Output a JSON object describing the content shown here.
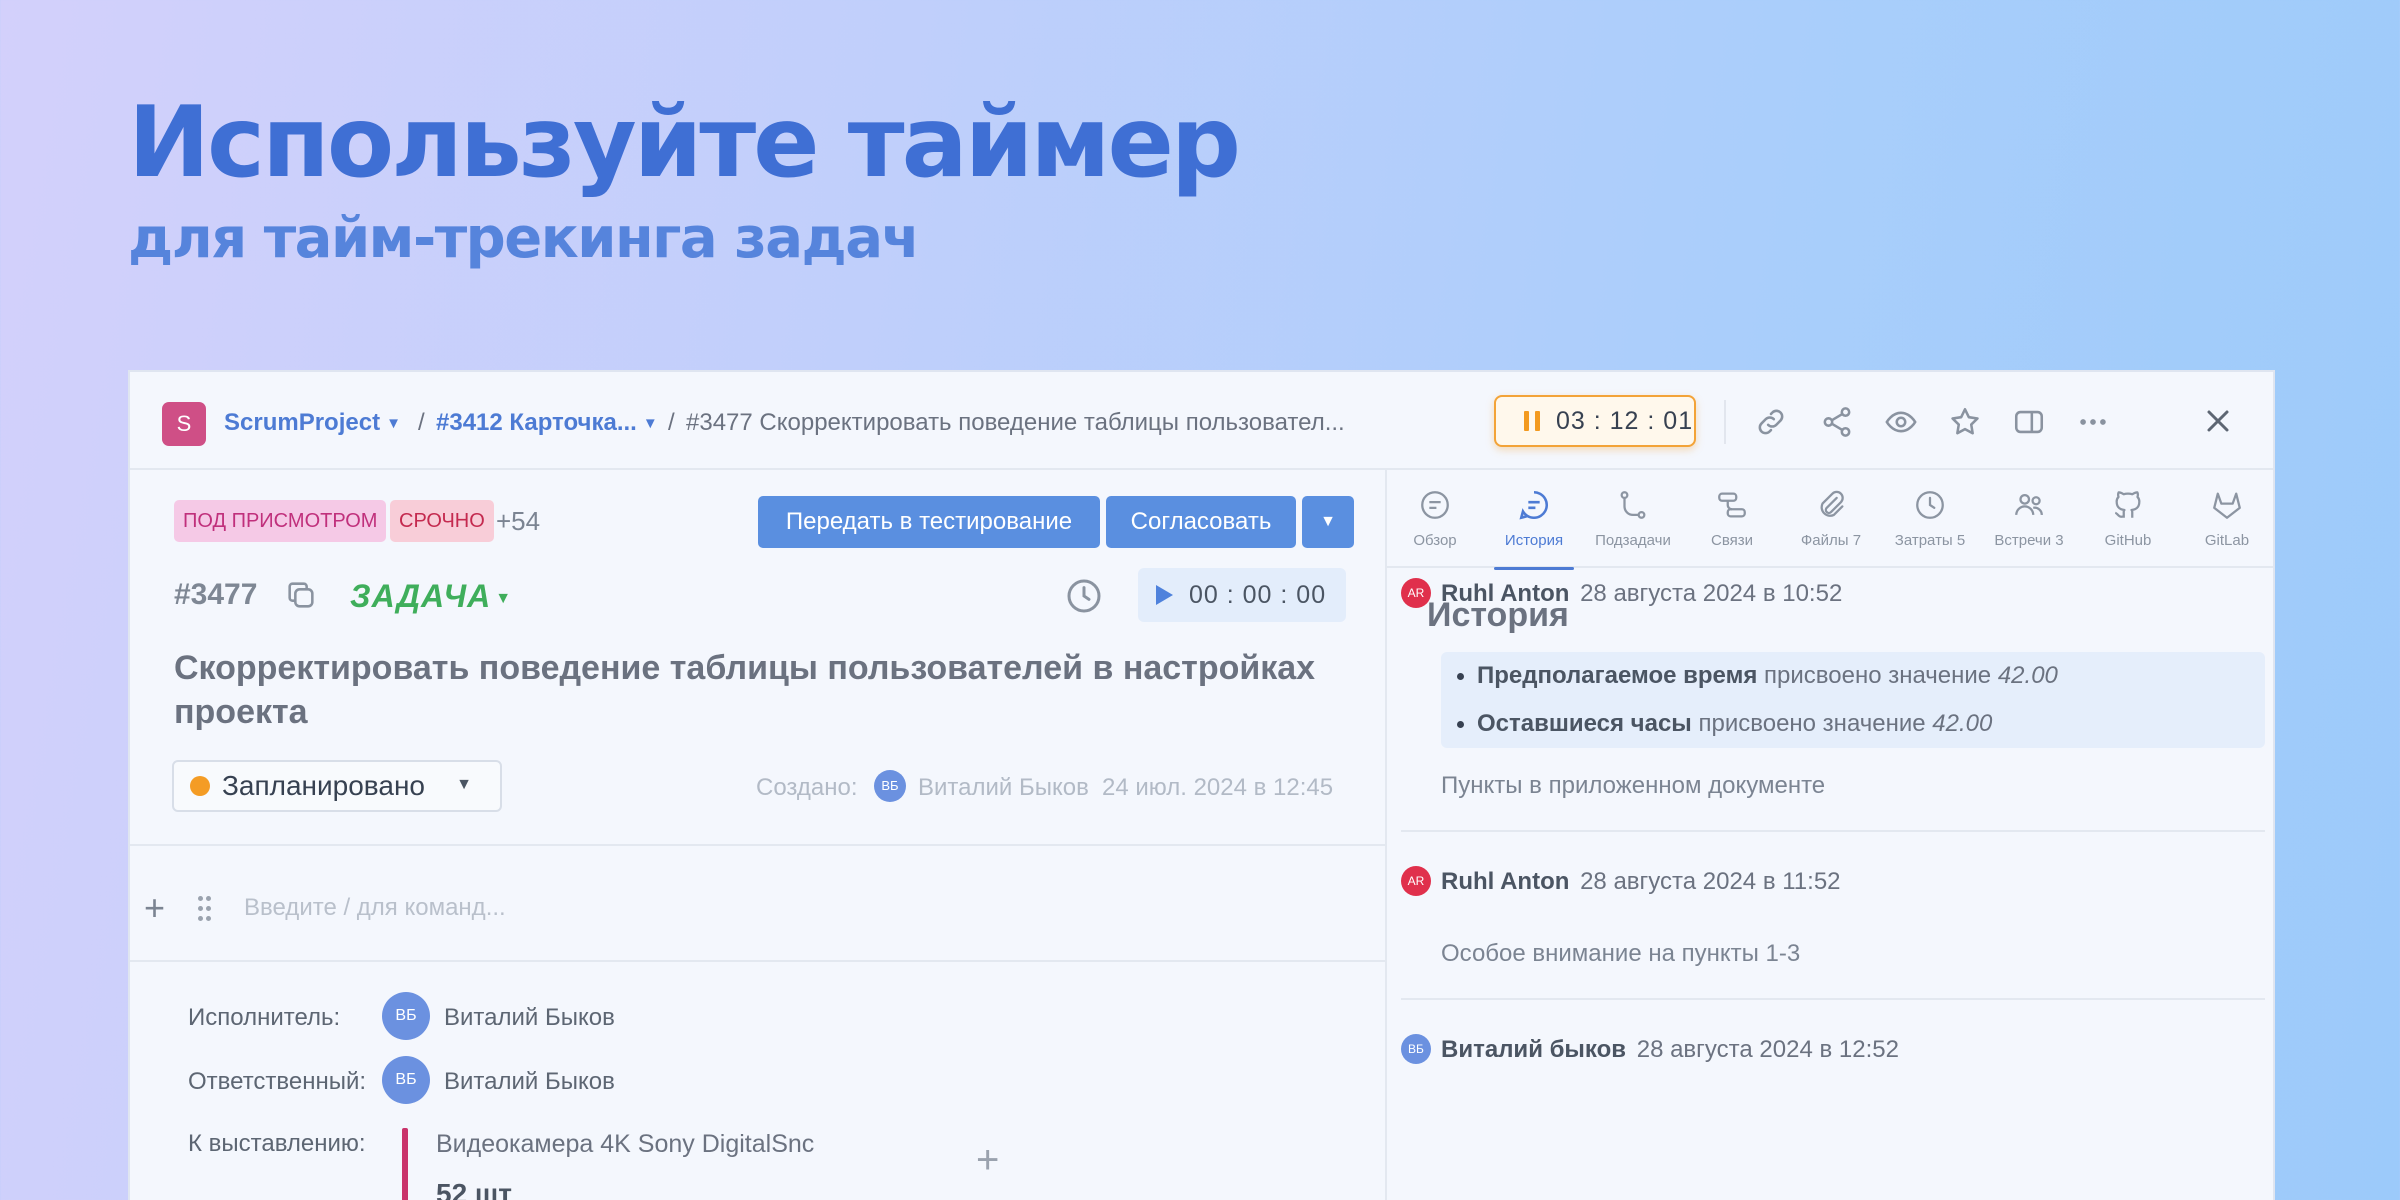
{
  "hero": {
    "title": "Используйте таймер",
    "subtitle": "для тайм-трекинга задач"
  },
  "breadcrumbs": {
    "project_initial": "S",
    "project": "ScrumProject",
    "sep": "/",
    "parent": "#3412 Карточка...",
    "current": "#3477 Скорректировать поведение таблицы пользовател..."
  },
  "header_timer": "03 : 12 : 01",
  "toolbar_icons": [
    "link-icon",
    "share-icon",
    "eye-icon",
    "star-icon",
    "sidebar-icon",
    "more-icon",
    "close-icon"
  ],
  "task": {
    "tags": [
      "ПОД ПРИСМОТРОМ",
      "СРОЧНО"
    ],
    "tags_more": "+54",
    "actions": [
      "Передать в тестирование",
      "Согласовать"
    ],
    "number": "#3477",
    "type": "ЗАДАЧА",
    "timer": "00 : 00 : 00",
    "title": "Скорректировать поведение таблицы пользователей в настройках проекта",
    "status": "Запланировано",
    "status_color": "#f49c25",
    "created_label": "Создано:",
    "created_initials": "ВБ",
    "created_by": "Виталий Быков",
    "created_at": "24 июл. 2024 в 12:45",
    "editor_placeholder": "Введите / для команд..."
  },
  "fields": {
    "assignee_label": "Исполнитель:",
    "assignee_initials": "ВБ",
    "assignee": "Виталий Быков",
    "responsible_label": "Ответственный:",
    "responsible_initials": "ВБ",
    "responsible": "Виталий Быков",
    "billing_label": "К выставлению:",
    "product_name": "Видеокамера 4K Sony DigitalSnc",
    "product_qty": "52 шт"
  },
  "tabs": [
    {
      "label": "Обзор",
      "icon": "overview-icon"
    },
    {
      "label": "История",
      "icon": "history-icon",
      "active": true
    },
    {
      "label": "Подзадачи",
      "icon": "subtasks-icon"
    },
    {
      "label": "Связи",
      "icon": "links-icon"
    },
    {
      "label": "Файлы 7",
      "icon": "paperclip-icon"
    },
    {
      "label": "Затраты 5",
      "icon": "clock-icon"
    },
    {
      "label": "Встречи 3",
      "icon": "people-icon"
    },
    {
      "label": "GitHub",
      "icon": "github-icon"
    },
    {
      "label": "GitLab",
      "icon": "gitlab-icon"
    }
  ],
  "history": {
    "title": "История",
    "entries": [
      {
        "initials": "AR",
        "author": "Ruhl Anton",
        "date": "28 августа 2024 в 10:52",
        "changes": [
          {
            "field": "Предполагаемое время",
            "text": "присвоено значение",
            "value": "42.00"
          },
          {
            "field": "Оставшиеся часы",
            "text": "присвоено значение",
            "value": "42.00"
          }
        ],
        "comment": "Пункты в приложенном документе"
      },
      {
        "initials": "AR",
        "author": "Ruhl Anton",
        "date": "28 августа 2024 в 11:52",
        "comment": "Особое внимание на пункты 1-3"
      },
      {
        "initials": "ВБ",
        "author": "Виталий быков",
        "date": "28 августа 2024 в 12:52"
      }
    ]
  }
}
